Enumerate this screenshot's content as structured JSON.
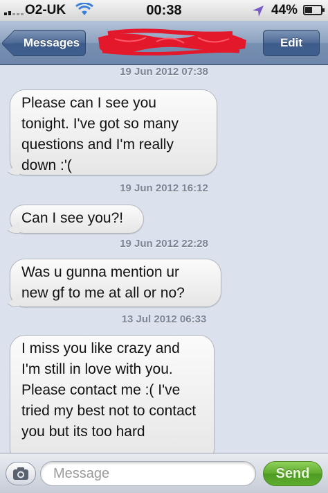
{
  "status_bar": {
    "carrier": "O2-UK",
    "time": "00:38",
    "battery_percent_label": "44%",
    "battery_level": 0.44,
    "signal_bars": 2,
    "signal_bars_total": 5,
    "icons": [
      "signal-icon",
      "wifi-icon",
      "location-arrow-icon",
      "battery-icon"
    ]
  },
  "nav": {
    "back_label": "Messages",
    "edit_label": "Edit",
    "title_redacted": true,
    "redaction_color": "#e3182b"
  },
  "conversation": {
    "messages": [
      {
        "timestamp": "19 Jun 2012 07:38",
        "text": "Please can I see you tonight. I've got so many questions and I'm really down :'("
      },
      {
        "timestamp": "19 Jun 2012 16:12",
        "text": "Can I see you?!"
      },
      {
        "timestamp": "19 Jun 2012 22:28",
        "text": "Was u gunna mention ur new gf to me at all or no?"
      },
      {
        "timestamp": "13 Jul 2012 06:33",
        "text": "I miss you like crazy and I'm still in love with you. Please contact me :( I've tried my best not to contact you but its too hard"
      }
    ]
  },
  "input_bar": {
    "placeholder": "Message",
    "send_label": "Send",
    "send_color": "#5faa2d"
  }
}
